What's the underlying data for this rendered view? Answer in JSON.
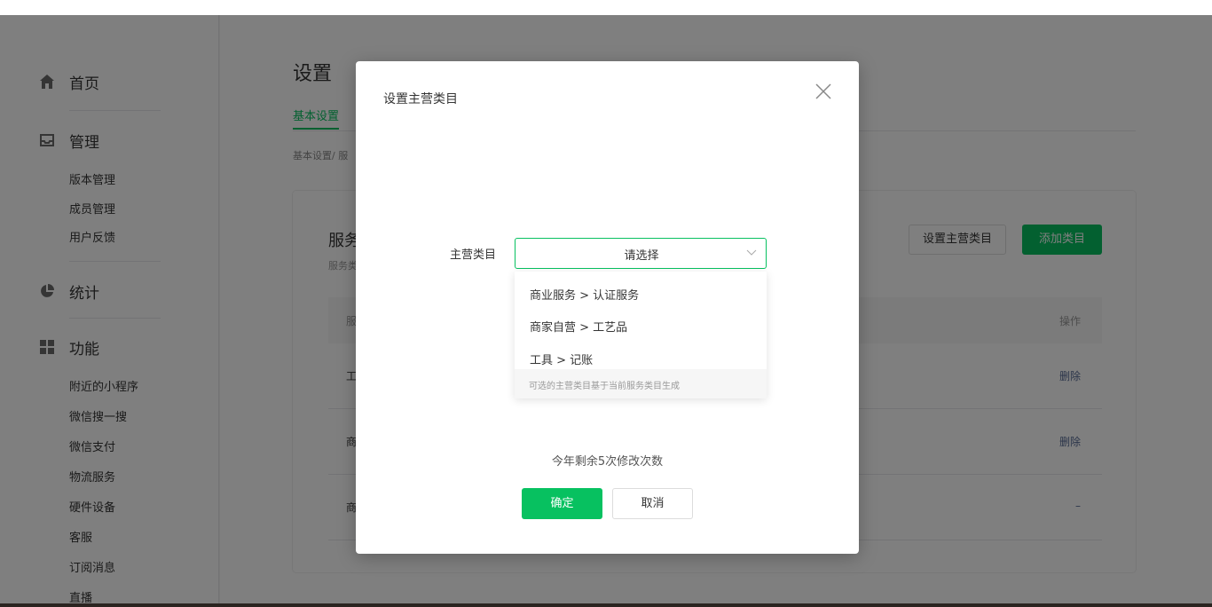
{
  "sidebar": {
    "home": {
      "label": "首页",
      "icon": "home-icon"
    },
    "manage": {
      "label": "管理",
      "icon": "inbox-icon",
      "items": [
        "版本管理",
        "成员管理",
        "用户反馈"
      ]
    },
    "stats": {
      "label": "统计",
      "icon": "pie-chart-icon"
    },
    "features": {
      "label": "功能",
      "icon": "grid-icon",
      "items": [
        "附近的小程序",
        "微信搜一搜",
        "微信支付",
        "物流服务",
        "硬件设备",
        "客服",
        "订阅消息",
        "直播"
      ]
    }
  },
  "main": {
    "title": "设置",
    "tab": "基本设置",
    "breadcrumb": "基本设置/ 服",
    "card": {
      "title": "服务",
      "subtitle": "服务类",
      "set_main_button": "设置主营类目",
      "add_button": "添加类目",
      "table": {
        "header_name": "服",
        "header_op": "操作",
        "rows": [
          {
            "name": "工",
            "op": "删除"
          },
          {
            "name": "商",
            "op": "删除"
          },
          {
            "name": "商",
            "op": "–"
          }
        ]
      }
    }
  },
  "modal": {
    "title": "设置主营类目",
    "field_label": "主营类目",
    "select_placeholder": "请选择",
    "options": [
      "商业服务 > 认证服务",
      "商家自营 > 工艺品",
      "工具 > 记账"
    ],
    "hint": "可选的主营类目基于当前服务类目生成",
    "remaining_text": "今年剩余5次修改次数",
    "confirm_label": "确定",
    "cancel_label": "取消"
  },
  "colors": {
    "accent": "#07c160",
    "link": "#576b95",
    "overlay": "rgba(0,0,0,0.5)"
  }
}
